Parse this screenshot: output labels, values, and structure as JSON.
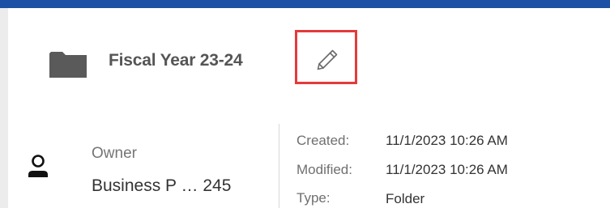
{
  "colors": {
    "accent_bar": "#1e4fa6",
    "highlight_border": "#e53a3a",
    "folder_icon": "#5a5a5a"
  },
  "header": {
    "folder_title": "Fiscal Year 23-24",
    "folder_icon": "folder-icon",
    "edit_icon": "pencil-icon"
  },
  "owner": {
    "icon": "person-icon",
    "label": "Owner",
    "value": "Business P … 245"
  },
  "details": {
    "created_label": "Created:",
    "created_value": "11/1/2023 10:26 AM",
    "modified_label": "Modified:",
    "modified_value": "11/1/2023 10:26 AM",
    "type_label": "Type:",
    "type_value": "Folder"
  }
}
